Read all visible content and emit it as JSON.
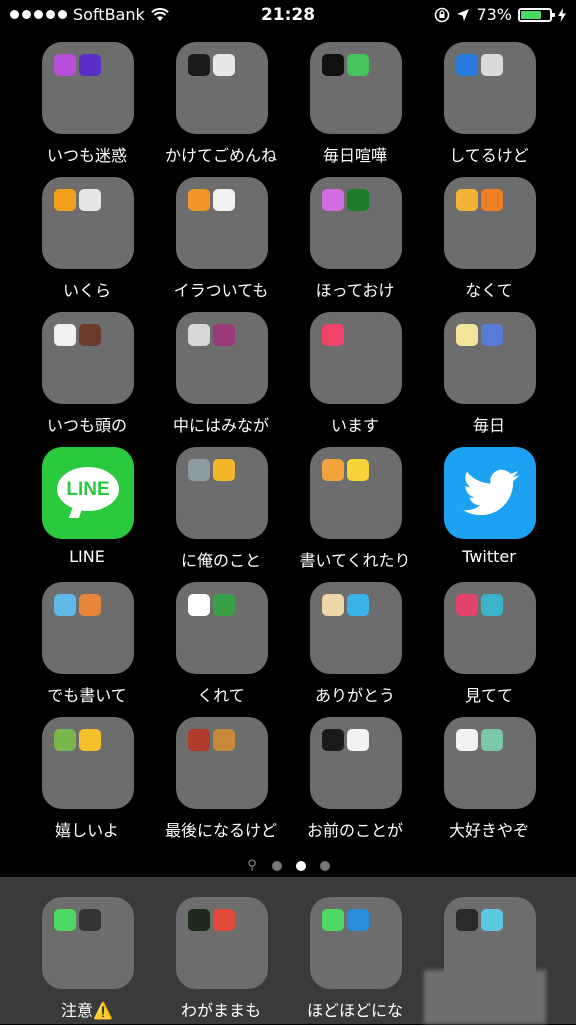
{
  "status_bar": {
    "carrier": "SoftBank",
    "time": "21:28",
    "battery_percent": "73%",
    "battery_level": 0.73
  },
  "pages": {
    "count": 3,
    "active": 1
  },
  "grid": [
    {
      "label": "いつも迷惑",
      "minis": [
        "#b84fd8",
        "#5a2fc8"
      ]
    },
    {
      "label": "かけてごめんね",
      "minis": [
        "#1a1a1a",
        "#e8e8e8"
      ]
    },
    {
      "label": "毎日喧嘩",
      "minis": [
        "#111111",
        "#47c45d"
      ]
    },
    {
      "label": "してるけど",
      "minis": [
        "#2a7de0",
        "#d9d9d9"
      ]
    },
    {
      "label": "いくら",
      "minis": [
        "#f4a11d",
        "#e6e6e6"
      ]
    },
    {
      "label": "イラついても",
      "minis": [
        "#f0962a",
        "#f2f2f2"
      ]
    },
    {
      "label": "ほっておけ",
      "minis": [
        "#d06de0",
        "#1e7b2b"
      ]
    },
    {
      "label": "なくて",
      "minis": [
        "#f3b334",
        "#ef7f24"
      ]
    },
    {
      "label": "いつも頭の",
      "minis": [
        "#f0f0f0",
        "#6b3a2a"
      ]
    },
    {
      "label": "中にはみなが",
      "minis": [
        "#d7d7d7",
        "#9b3a7a"
      ]
    },
    {
      "label": "います",
      "minis": [
        "#f0436a"
      ]
    },
    {
      "label": "毎日",
      "minis": [
        "#f4e59a",
        "#5b7bd8"
      ]
    },
    {
      "label": "LINE",
      "app": "line",
      "app_text": "LINE"
    },
    {
      "label": "に俺のこと",
      "minis": [
        "#8f9aa3",
        "#f4b62a"
      ]
    },
    {
      "label": "書いてくれたり",
      "minis": [
        "#f2a43b",
        "#f7d43a"
      ]
    },
    {
      "label": "Twitter",
      "app": "twitter"
    },
    {
      "label": "でも書いて",
      "minis": [
        "#5fb9e6",
        "#e7863a"
      ]
    },
    {
      "label": "くれて",
      "minis": [
        "#ffffff",
        "#3aa04a"
      ]
    },
    {
      "label": "ありがとう",
      "minis": [
        "#efd6a8",
        "#39b2e8"
      ]
    },
    {
      "label": "見てて",
      "minis": [
        "#e3456a",
        "#3ab4c8"
      ]
    },
    {
      "label": "嬉しいよ",
      "minis": [
        "#7ab54b",
        "#f5c12a"
      ]
    },
    {
      "label": "最後になるけど",
      "minis": [
        "#b03a2a",
        "#c88a3a"
      ]
    },
    {
      "label": "お前のことが",
      "minis": [
        "#1a1a1a",
        "#f2f2f2"
      ]
    },
    {
      "label": "大好きやぞ",
      "minis": [
        "#f2f2f2",
        "#7bc9a8"
      ]
    }
  ],
  "dock": [
    {
      "label": "注意⚠️",
      "minis": [
        "#4cd964",
        "#333333"
      ]
    },
    {
      "label": "わがままも",
      "minis": [
        "#1d2a1d",
        "#e34a3a"
      ]
    },
    {
      "label": "ほどほどにな",
      "minis": [
        "#4cd964",
        "#2a8de0"
      ]
    },
    {
      "label": "",
      "minis": [
        "#2a2a2a",
        "#5ac8e0"
      ]
    }
  ]
}
